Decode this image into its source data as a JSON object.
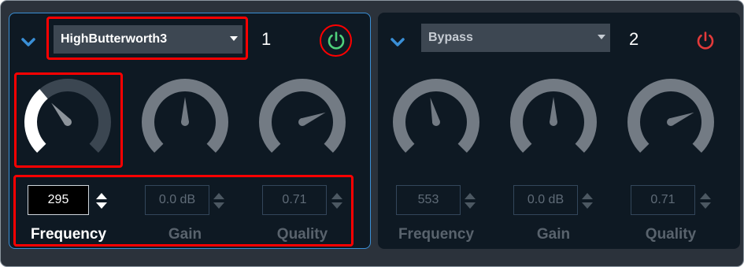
{
  "colors": {
    "accent": "#3a8fd6",
    "power_on": "#4fd07c",
    "power_off": "#e23a3a",
    "highlight": "#ff0000"
  },
  "bands": [
    {
      "index": "1",
      "filter_type": "HighButterworth3",
      "power": "on",
      "active": true,
      "params": [
        {
          "name": "Frequency",
          "value": "295",
          "level": 0.35
        },
        {
          "name": "Gain",
          "value": "0.0 dB",
          "level": 0.5
        },
        {
          "name": "Quality",
          "value": "0.71",
          "level": 0.75
        }
      ]
    },
    {
      "index": "2",
      "filter_type": "Bypass",
      "power": "off",
      "active": false,
      "params": [
        {
          "name": "Frequency",
          "value": "553",
          "level": 0.45
        },
        {
          "name": "Gain",
          "value": "0.0 dB",
          "level": 0.5
        },
        {
          "name": "Quality",
          "value": "0.71",
          "level": 0.75
        }
      ]
    }
  ]
}
